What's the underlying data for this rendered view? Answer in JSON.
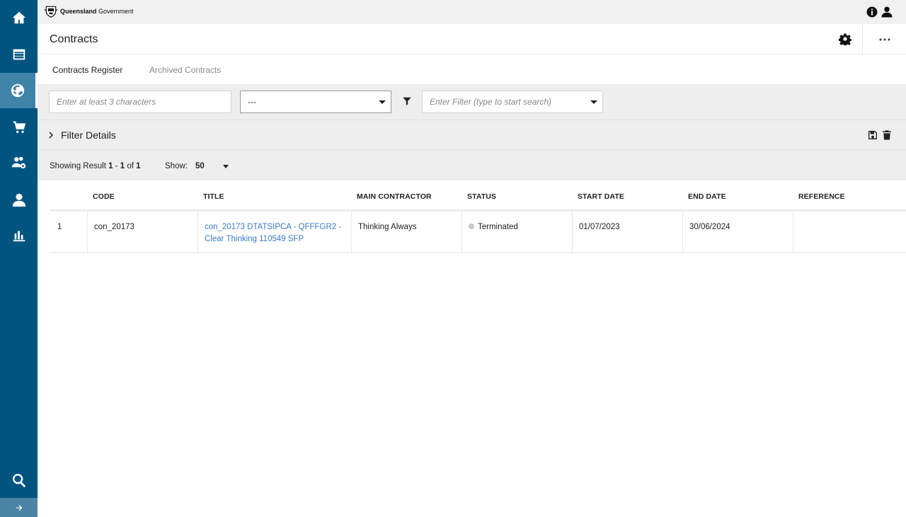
{
  "sidebar": {
    "items": [
      {
        "icon": "home-icon"
      },
      {
        "icon": "dashboard-icon"
      },
      {
        "icon": "globe-handshake-icon",
        "active": true
      },
      {
        "icon": "cart-icon"
      },
      {
        "icon": "people-settings-icon"
      },
      {
        "icon": "person-icon"
      },
      {
        "icon": "bar-chart-icon"
      }
    ],
    "search_icon": "search-icon",
    "collapse_icon": "arrow-right-icon"
  },
  "topbar": {
    "logo_bold": "Queensland",
    "logo_rest": "Government",
    "info_icon": "info-icon",
    "user_icon": "user-icon"
  },
  "header": {
    "title": "Contracts"
  },
  "tabs": [
    {
      "label": "Contracts Register",
      "active": true
    },
    {
      "label": "Archived Contracts",
      "active": false
    }
  ],
  "filters": {
    "search_placeholder": "Enter at least 3 characters",
    "select_value": "---",
    "filter_placeholder": "Enter Filter (type to start search)"
  },
  "details": {
    "label": "Filter Details"
  },
  "results": {
    "prefix": "Showing Result ",
    "from": "1",
    "sep": " - ",
    "to": "1",
    "of": " of ",
    "total": "1",
    "show_label": "Show:",
    "show_value": "50"
  },
  "table": {
    "headers": [
      "CODE",
      "TITLE",
      "MAIN CONTRACTOR",
      "STATUS",
      "START DATE",
      "END DATE",
      "REFERENCE"
    ],
    "rows": [
      {
        "index": "1",
        "code": "con_20173",
        "title_line1": "con_20173 DTATSIPCA - QFFFGR2 -",
        "title_line2": "Clear Thinking 110549 SFP",
        "contractor": "Thinking Always",
        "status": "Terminated",
        "start_date": "01/07/2023",
        "end_date": "30/06/2024",
        "reference": ""
      }
    ]
  },
  "colors": {
    "sidebar": "#005580",
    "sidebar_active": "#3f84a8",
    "link": "#3a79c9",
    "status_terminated": "#c9c9c9"
  }
}
